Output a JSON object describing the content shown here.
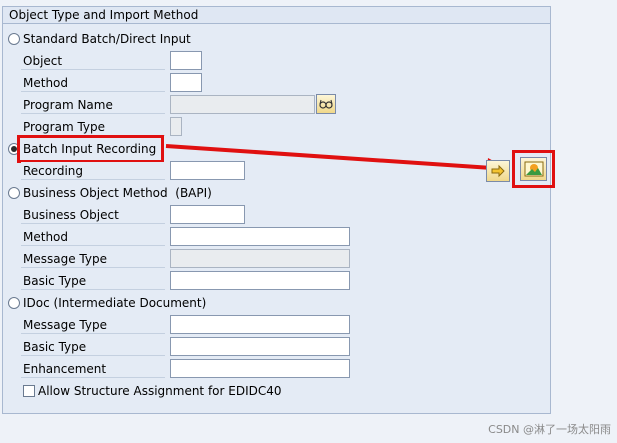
{
  "group": {
    "title": "Object Type and Import Method"
  },
  "options": {
    "standard": "Standard Batch/Direct Input",
    "recording": "Batch Input Recording",
    "bapi": "Business Object Method  (BAPI)",
    "idoc": "IDoc (Intermediate Document)"
  },
  "labels": {
    "object": "Object",
    "method": "Method",
    "program_name": "Program Name",
    "program_type": "Program Type",
    "recording": "Recording",
    "business_object": "Business Object",
    "bapi_method": "Method",
    "message_type": "Message Type",
    "basic_type": "Basic Type",
    "idoc_message_type": "Message Type",
    "idoc_basic_type": "Basic Type",
    "enhancement": "Enhancement",
    "allow_structure": "Allow Structure Assignment for EDIDC40"
  },
  "values": {
    "object": "",
    "method": "",
    "program_name": "",
    "program_type": "",
    "recording": "",
    "business_object": "",
    "bapi_method": "",
    "message_type": "",
    "basic_type": "",
    "idoc_message_type": "",
    "idoc_basic_type": "",
    "enhancement": ""
  },
  "selected_option": "recording",
  "icons": {
    "program_name_help": "glasses-icon",
    "next": "arrow-right-icon",
    "overview": "picture-icon"
  },
  "colors": {
    "highlight": "#e01010"
  },
  "watermark": "CSDN @淋了一场太阳雨"
}
